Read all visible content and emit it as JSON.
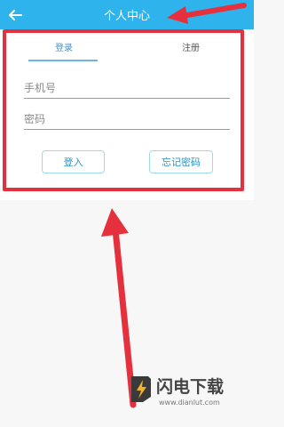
{
  "header": {
    "title": "个人中心"
  },
  "tabs": {
    "login": "登录",
    "register": "注册"
  },
  "form": {
    "phone_placeholder": "手机号",
    "password_placeholder": "密码",
    "login_button": "登入",
    "forgot_button": "忘记密码"
  },
  "watermark": {
    "name": "闪电下载",
    "url": "www.dianlut.com"
  },
  "icons": {
    "back": "back-arrow-icon",
    "logo": "lightning-logo-icon"
  },
  "colors": {
    "header_bg": "#2fb3ec",
    "annotation_red": "#e5303d",
    "button_border": "#9fd8ef",
    "button_text": "#2d93c9"
  }
}
